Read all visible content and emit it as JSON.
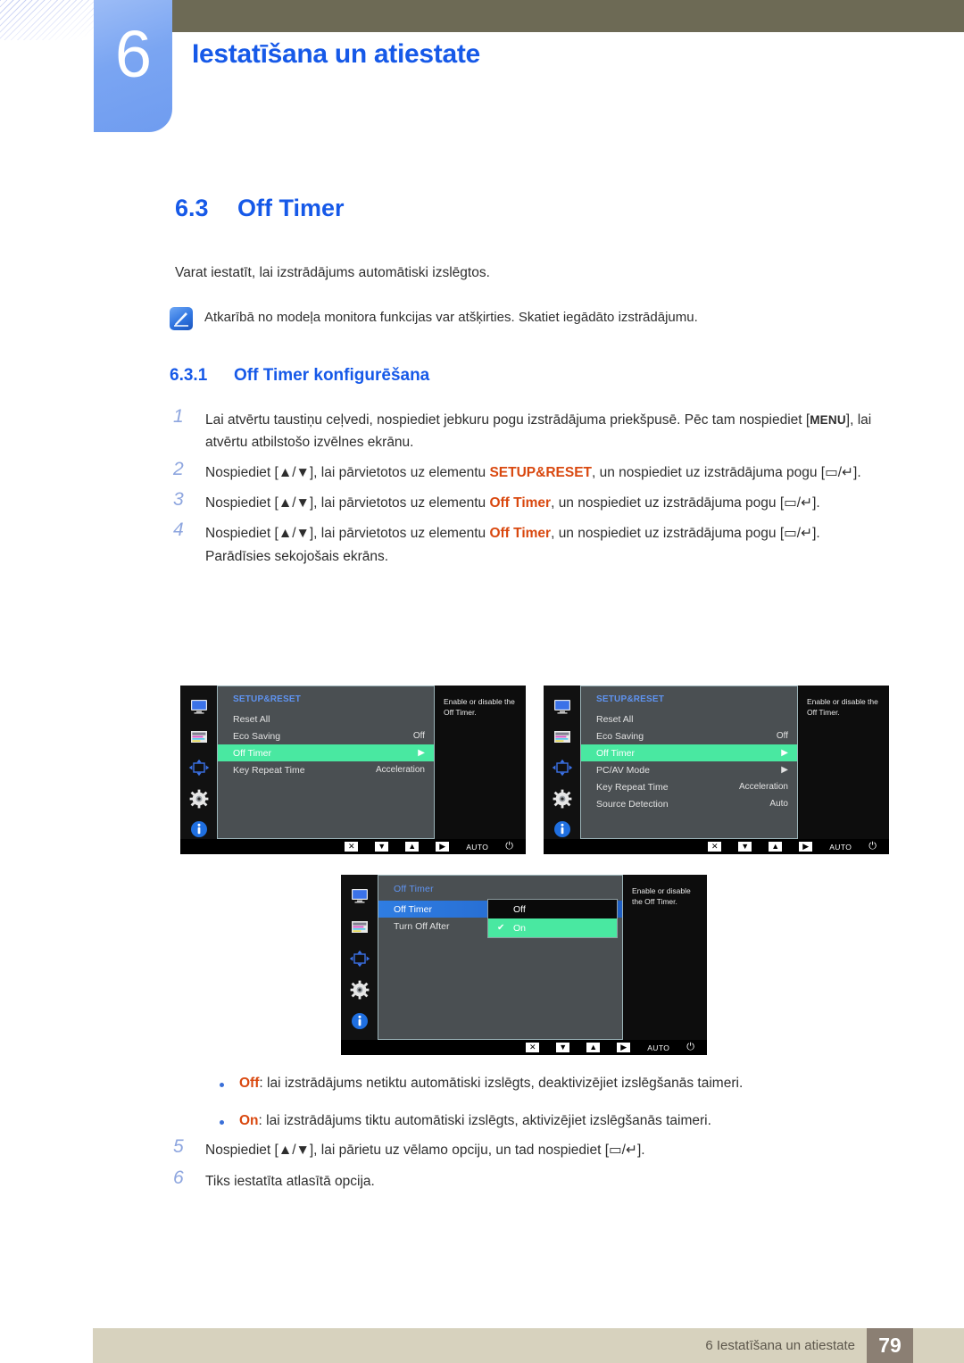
{
  "header": {
    "chapter_number": "6",
    "chapter_title": "Iestatīšana un atiestate"
  },
  "section": {
    "number": "6.3",
    "title": "Off Timer",
    "intro": "Varat iestatīt, lai izstrādājums automātiski izslēgtos.",
    "note": "Atkarībā no modeļa monitora funkcijas var atšķirties. Skatiet iegādāto izstrādājumu.",
    "sub_number": "6.3.1",
    "sub_title": "Off Timer konfigurēšana"
  },
  "steps": [
    {
      "no": "1",
      "parts": [
        {
          "t": "Lai atvērtu taustiņu ceļvedi, nospiediet jebkuru pogu izstrādājuma priekšpusē. Pēc tam nospiediet [",
          "s": "plain"
        },
        {
          "t": "MENU",
          "s": "menu"
        },
        {
          "t": "], lai atvērtu atbilstošo izvēlnes ekrānu.",
          "s": "plain"
        }
      ]
    },
    {
      "no": "2",
      "parts": [
        {
          "t": "Nospiediet [▲/▼], lai pārvietotos uz elementu ",
          "s": "plain"
        },
        {
          "t": "SETUP&RESET",
          "s": "orange"
        },
        {
          "t": ", un nospiediet uz izstrādājuma pogu [▭/↵].",
          "s": "plain"
        }
      ]
    },
    {
      "no": "3",
      "parts": [
        {
          "t": "Nospiediet [▲/▼], lai pārvietotos uz elementu ",
          "s": "plain"
        },
        {
          "t": "Off Timer",
          "s": "orange"
        },
        {
          "t": ", un nospiediet uz izstrādājuma pogu [▭/↵].",
          "s": "plain"
        }
      ]
    },
    {
      "no": "4",
      "parts": [
        {
          "t": "Nospiediet [▲/▼], lai pārvietotos uz elementu ",
          "s": "plain"
        },
        {
          "t": "Off Timer",
          "s": "orange"
        },
        {
          "t": ", un nospiediet uz izstrādājuma pogu [▭/↵].",
          "s": "plain"
        }
      ],
      "extra": "Parādīsies sekojošais ekrāns."
    }
  ],
  "bullets": [
    {
      "label": "Off",
      "text": ": lai izstrādājums netiktu automātiski izslēgts, deaktivizējiet izslēgšanās taimeri."
    },
    {
      "label": "On",
      "text": ": lai izstrādājums tiktu automātiski izslēgts, aktivizējiet izslēgšanās taimeri."
    }
  ],
  "steps_after": [
    {
      "no": "5",
      "parts": [
        {
          "t": "Nospiediet [▲/▼], lai pārietu uz vēlamo opciju, un tad nospiediet [▭/↵].",
          "s": "plain"
        }
      ]
    },
    {
      "no": "6",
      "parts": [
        {
          "t": "Tiks iestatīta atlasītā opcija.",
          "s": "plain"
        }
      ]
    }
  ],
  "osd": {
    "help_text": "Enable or disable the Off Timer.",
    "side_icons": [
      "monitor-icon",
      "picture-color-icon",
      "position-arrows-icon",
      "gear-icon",
      "info-icon"
    ],
    "bottom_buttons": [
      "close-button",
      "down-button",
      "up-button",
      "right-button",
      "auto-button",
      "power-button"
    ],
    "bottom_labels": {
      "close": "✕",
      "down": "▼",
      "up": "▲",
      "right": "▶",
      "auto": "AUTO",
      "power": "⏻"
    },
    "screen1": {
      "category": "SETUP&RESET",
      "items": [
        {
          "label": "Reset All",
          "value": "",
          "state": "normal"
        },
        {
          "label": "Eco Saving",
          "value": "Off",
          "state": "normal"
        },
        {
          "label": "Off Timer",
          "value": "▶",
          "state": "selected-green"
        },
        {
          "label": "Key Repeat Time",
          "value": "Acceleration",
          "state": "normal"
        }
      ]
    },
    "screen2": {
      "category": "SETUP&RESET",
      "items": [
        {
          "label": "Reset All",
          "value": "",
          "state": "normal"
        },
        {
          "label": "Eco Saving",
          "value": "Off",
          "state": "normal"
        },
        {
          "label": "Off Timer",
          "value": "▶",
          "state": "selected-green"
        },
        {
          "label": "PC/AV Mode",
          "value": "▶",
          "state": "normal"
        },
        {
          "label": "Key Repeat Time",
          "value": "Acceleration",
          "state": "normal"
        },
        {
          "label": "Source Detection",
          "value": "Auto",
          "state": "normal"
        }
      ]
    },
    "screen3": {
      "category": "Off Timer",
      "items": [
        {
          "label": "Off Timer",
          "value": "",
          "state": "selected-blue"
        },
        {
          "label": "Turn Off After",
          "value": "",
          "state": "normal"
        }
      ],
      "popup": [
        {
          "label": "Off",
          "checked": false
        },
        {
          "label": "On",
          "checked": true
        }
      ],
      "check_glyph": "✔"
    }
  },
  "footer": {
    "text": "6 Iestatīšana un atiestate",
    "page": "79"
  },
  "colors": {
    "accent_blue": "#1659e8",
    "olive": "#6d6a55",
    "tab_blue": "#7aa5f2",
    "orange": "#d9480f",
    "footer_bar": "#d7d2be",
    "page_box": "#8b7f73",
    "osd_green": "#49e8a1"
  }
}
